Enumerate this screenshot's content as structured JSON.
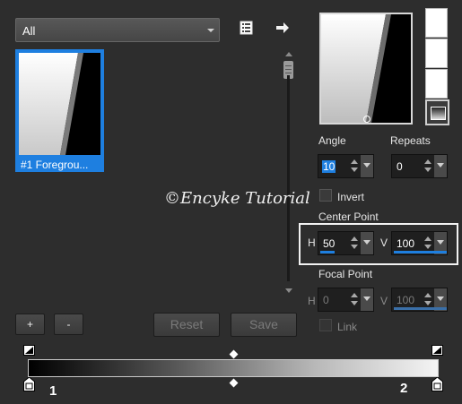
{
  "preset_filter": {
    "selected": "All"
  },
  "presets": [
    {
      "label": "#1 Foregrou..."
    }
  ],
  "preset_buttons": {
    "add": "+",
    "remove": "-"
  },
  "actions": {
    "reset": "Reset",
    "save": "Save"
  },
  "watermark": "©Encyke Tutorial",
  "settings": {
    "angle": {
      "label": "Angle",
      "value": "10"
    },
    "repeats": {
      "label": "Repeats",
      "value": "0"
    },
    "invert": {
      "label": "Invert",
      "checked": false
    },
    "center_point": {
      "label": "Center Point",
      "h_label": "H",
      "h_value": "50",
      "v_label": "V",
      "v_value": "100",
      "h_fill": 0.5,
      "v_fill": 1.0
    },
    "focal_point": {
      "label": "Focal Point",
      "h_label": "H",
      "h_value": "0",
      "v_label": "V",
      "v_value": "100",
      "h_fill": 0.0,
      "v_fill": 1.0
    },
    "link": {
      "label": "Link",
      "checked": false
    }
  },
  "gradient_stops": {
    "left_label": "1",
    "right_label": "2"
  },
  "colors": {
    "accent": "#1e7fe0",
    "background": "#2d2d2d"
  },
  "icons": [
    "list-icon",
    "export-arrow-icon",
    "gradient-style-icon"
  ]
}
